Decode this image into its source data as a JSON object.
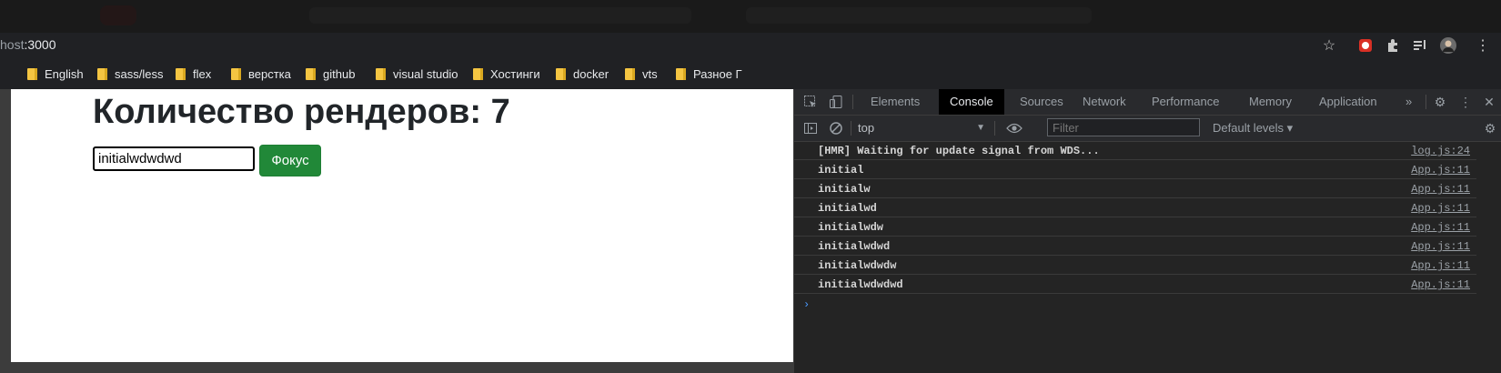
{
  "browser": {
    "url_prefix": "host",
    "url_rest": ":3000",
    "bookmarks": [
      "English",
      "sass/less",
      "flex",
      "верстка",
      "github",
      "visual studio",
      "Хостинги",
      "docker",
      "vts",
      "Разное Г"
    ]
  },
  "page": {
    "title": "Количество рендеров: 7",
    "input_value": "initialwdwdwd",
    "focus_button": "Фокус"
  },
  "devtools": {
    "tabs": [
      "Elements",
      "Console",
      "Sources",
      "Network",
      "Performance",
      "Memory",
      "Application"
    ],
    "active_tab": "Console",
    "more_tabs": "»",
    "context": "top",
    "filter_placeholder": "Filter",
    "levels": "Default levels ▾",
    "logs": [
      {
        "message": "[HMR] Waiting for update signal from WDS...",
        "source": "log.js:24"
      },
      {
        "message": "initial",
        "source": "App.js:11"
      },
      {
        "message": "initialw",
        "source": "App.js:11"
      },
      {
        "message": "initialwd",
        "source": "App.js:11"
      },
      {
        "message": "initialwdw",
        "source": "App.js:11"
      },
      {
        "message": "initialwdwd",
        "source": "App.js:11"
      },
      {
        "message": "initialwdwdw",
        "source": "App.js:11"
      },
      {
        "message": "initialwdwdwd",
        "source": "App.js:11"
      }
    ],
    "prompt": "›"
  },
  "colors": {
    "button_green": "#218838",
    "devtools_bg": "#242424",
    "folder_yellow": "#f4c542"
  }
}
